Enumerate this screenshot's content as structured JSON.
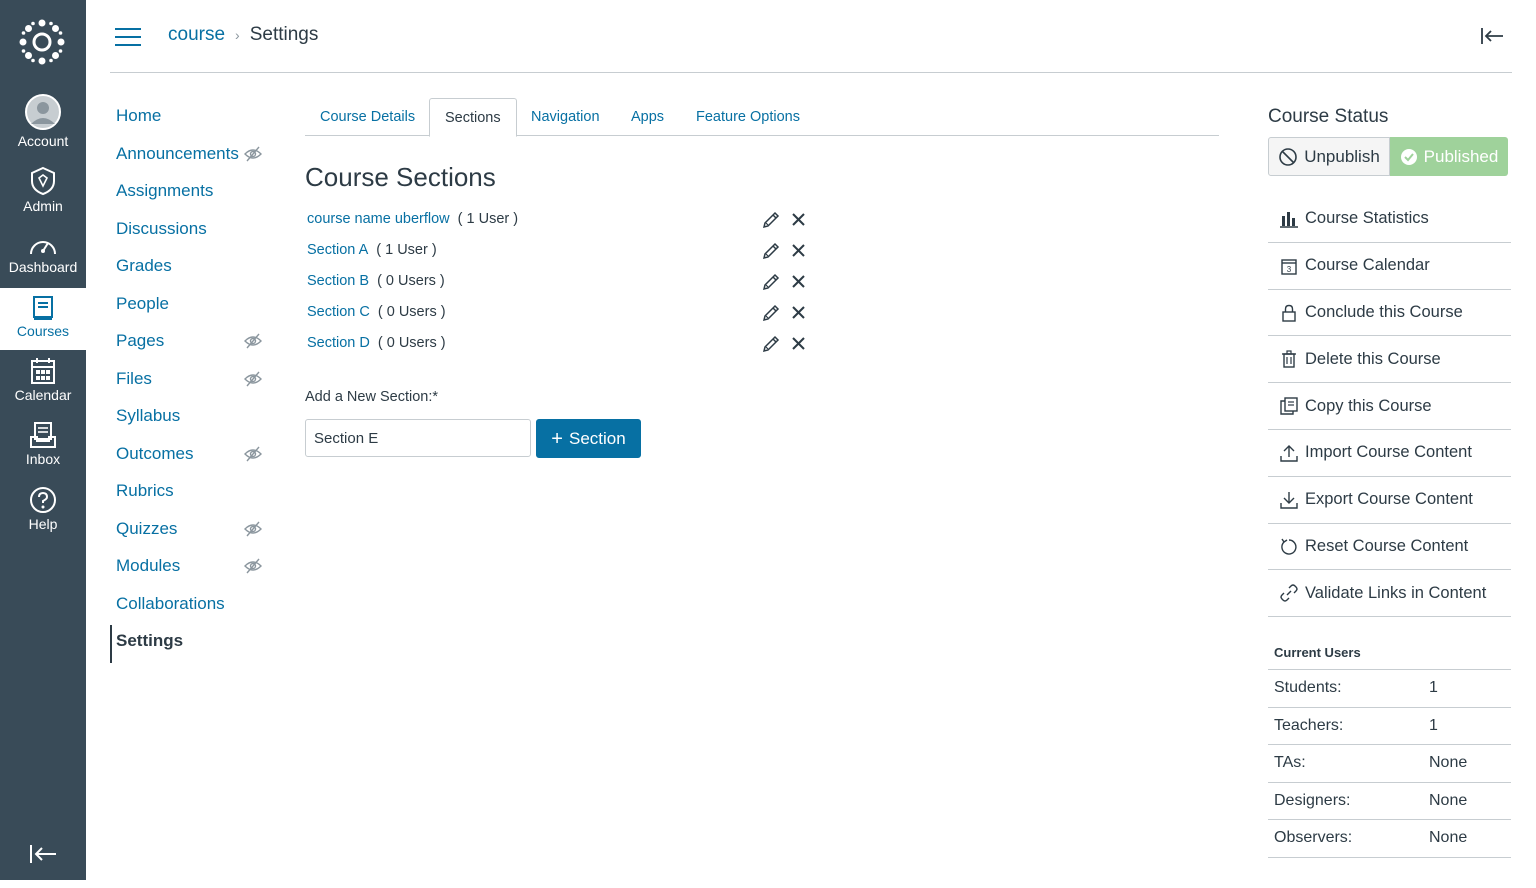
{
  "global_nav": {
    "items": [
      {
        "label": "Account",
        "icon": "account-icon"
      },
      {
        "label": "Admin",
        "icon": "admin-icon"
      },
      {
        "label": "Dashboard",
        "icon": "dashboard-icon"
      },
      {
        "label": "Courses",
        "icon": "courses-icon",
        "active": true
      },
      {
        "label": "Calendar",
        "icon": "calendar-icon"
      },
      {
        "label": "Inbox",
        "icon": "inbox-icon"
      },
      {
        "label": "Help",
        "icon": "help-icon"
      }
    ]
  },
  "breadcrumb": {
    "course": "course",
    "current": "Settings"
  },
  "course_nav": [
    {
      "label": "Home",
      "hidden": false
    },
    {
      "label": "Announcements",
      "hidden": true
    },
    {
      "label": "Assignments",
      "hidden": false
    },
    {
      "label": "Discussions",
      "hidden": false
    },
    {
      "label": "Grades",
      "hidden": false
    },
    {
      "label": "People",
      "hidden": false
    },
    {
      "label": "Pages",
      "hidden": true
    },
    {
      "label": "Files",
      "hidden": true
    },
    {
      "label": "Syllabus",
      "hidden": false
    },
    {
      "label": "Outcomes",
      "hidden": true
    },
    {
      "label": "Rubrics",
      "hidden": false
    },
    {
      "label": "Quizzes",
      "hidden": true
    },
    {
      "label": "Modules",
      "hidden": true
    },
    {
      "label": "Collaborations",
      "hidden": false
    },
    {
      "label": "Settings",
      "hidden": false,
      "active": true
    }
  ],
  "tabs": [
    "Course Details",
    "Sections",
    "Navigation",
    "Apps",
    "Feature Options"
  ],
  "active_tab": "Sections",
  "sections": {
    "title": "Course Sections",
    "items": [
      {
        "name": "course name uberflow",
        "count": "( 1 User )"
      },
      {
        "name": "Section A",
        "count": "( 1 User )"
      },
      {
        "name": "Section B",
        "count": "( 0 Users )"
      },
      {
        "name": "Section C",
        "count": "( 0 Users )"
      },
      {
        "name": "Section D",
        "count": "( 0 Users )"
      }
    ],
    "add_label": "Add a New Section:*",
    "add_value": "Section E",
    "add_button": "Section"
  },
  "course_status": {
    "title": "Course Status",
    "unpublish": "Unpublish",
    "published": "Published",
    "published_color": "#9fd29b"
  },
  "sidebar_links": [
    {
      "label": "Course Statistics",
      "icon": "bar-chart-icon"
    },
    {
      "label": "Course Calendar",
      "icon": "calendar-day-icon"
    },
    {
      "label": "Conclude this Course",
      "icon": "lock-icon"
    },
    {
      "label": "Delete this Course",
      "icon": "trash-icon"
    },
    {
      "label": "Copy this Course",
      "icon": "copy-icon"
    },
    {
      "label": "Import Course Content",
      "icon": "upload-icon"
    },
    {
      "label": "Export Course Content",
      "icon": "download-icon"
    },
    {
      "label": "Reset Course Content",
      "icon": "reset-icon"
    },
    {
      "label": "Validate Links in Content",
      "icon": "link-icon"
    }
  ],
  "current_users": {
    "title": "Current Users",
    "rows": [
      {
        "role": "Students:",
        "value": "1"
      },
      {
        "role": "Teachers:",
        "value": "1"
      },
      {
        "role": "TAs:",
        "value": "None"
      },
      {
        "role": "Designers:",
        "value": "None"
      },
      {
        "role": "Observers:",
        "value": "None"
      }
    ]
  },
  "colors": {
    "nav_bg": "#394b58",
    "link": "#0770a3",
    "primary_button": "#0770a3"
  }
}
